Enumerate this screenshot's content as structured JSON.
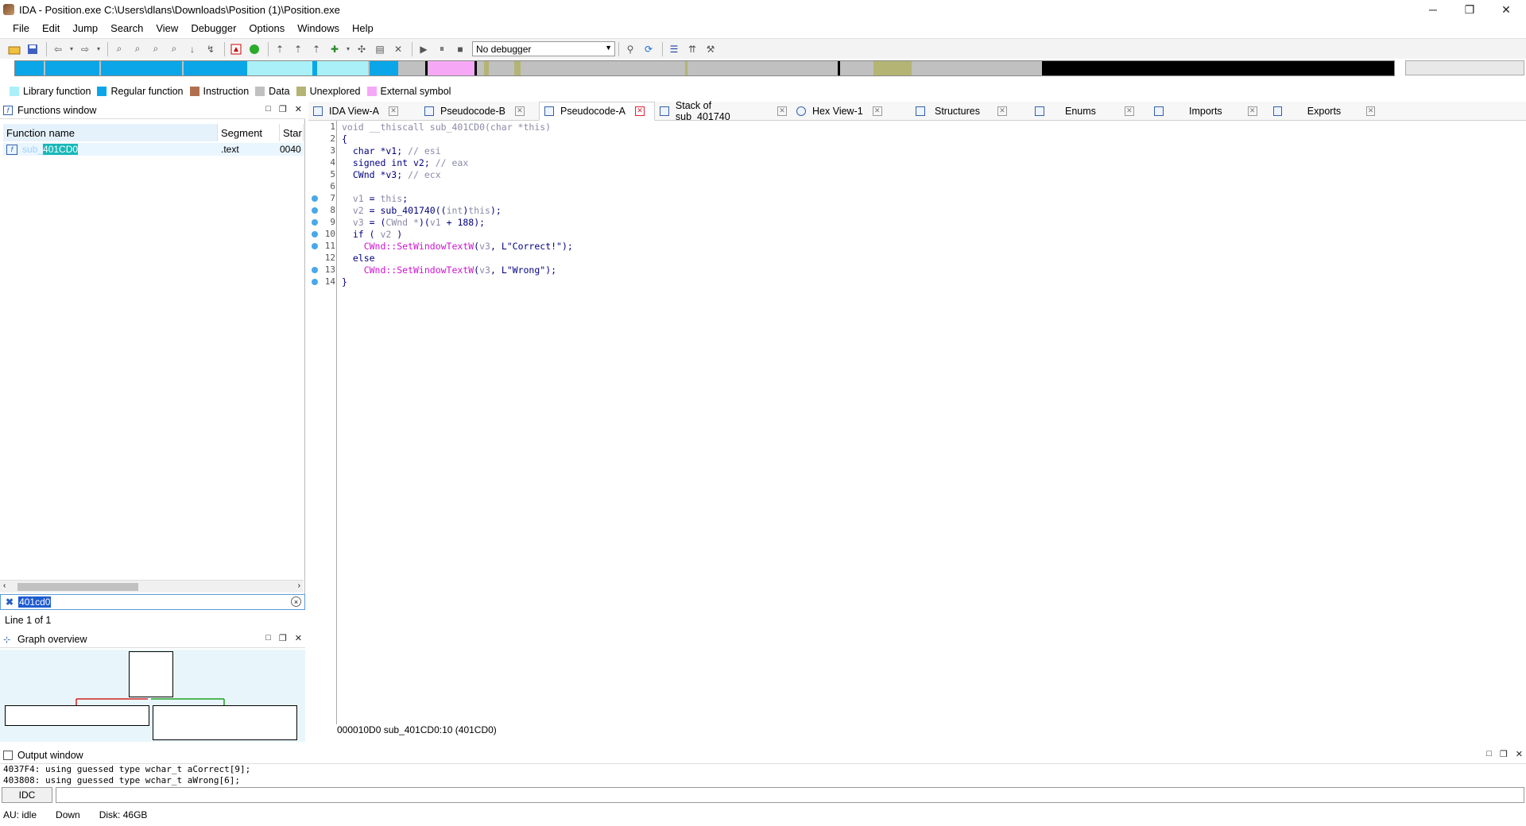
{
  "window": {
    "title": "IDA - Position.exe C:\\Users\\dlans\\Downloads\\Position (1)\\Position.exe",
    "minimize": "─",
    "restore": "❐",
    "close": "✕"
  },
  "menu": [
    "File",
    "Edit",
    "Jump",
    "Search",
    "View",
    "Debugger",
    "Options",
    "Windows",
    "Help"
  ],
  "toolbar": {
    "debugger_select": "No debugger"
  },
  "legend": [
    {
      "label": "Library function",
      "color": "#aaf0f8"
    },
    {
      "label": "Regular function",
      "color": "#0aa6e8"
    },
    {
      "label": "Instruction",
      "color": "#b07050"
    },
    {
      "label": "Data",
      "color": "#c0c0c0"
    },
    {
      "label": "Unexplored",
      "color": "#b4b474"
    },
    {
      "label": "External symbol",
      "color": "#f6a8f6"
    }
  ],
  "functions_window": {
    "title": "Functions window",
    "columns": [
      "Function name",
      "Segment",
      "Star"
    ],
    "rows": [
      {
        "name_prefix": "sub_",
        "name_highlight": "401CD0",
        "segment": ".text",
        "start": "0040"
      }
    ],
    "filter_value": "401cd0",
    "line_info": "Line 1 of 1"
  },
  "graph_overview": {
    "title": "Graph overview"
  },
  "tabs": [
    {
      "label": "IDA View-A",
      "active": false
    },
    {
      "label": "Pseudocode-B",
      "active": false
    },
    {
      "label": "Pseudocode-A",
      "active": true
    },
    {
      "label": "Stack of sub_401740",
      "active": false
    },
    {
      "label": "Hex View-1",
      "active": false
    },
    {
      "label": "Structures",
      "active": false
    },
    {
      "label": "Enums",
      "active": false
    },
    {
      "label": "Imports",
      "active": false
    },
    {
      "label": "Exports",
      "active": false
    }
  ],
  "code": {
    "lines": [
      {
        "n": "1",
        "dot": false
      },
      {
        "n": "2",
        "dot": false
      },
      {
        "n": "3",
        "dot": false
      },
      {
        "n": "4",
        "dot": false
      },
      {
        "n": "5",
        "dot": false
      },
      {
        "n": "6",
        "dot": false
      },
      {
        "n": "7",
        "dot": true
      },
      {
        "n": "8",
        "dot": true
      },
      {
        "n": "9",
        "dot": true
      },
      {
        "n": "10",
        "dot": true
      },
      {
        "n": "11",
        "dot": true
      },
      {
        "n": "12",
        "dot": false
      },
      {
        "n": "13",
        "dot": true
      },
      {
        "n": "14",
        "dot": true
      }
    ],
    "l1": "void __thiscall sub_401CD0(char *this)",
    "l2": "{",
    "l3a": "  char *v1; ",
    "l3b": "// esi",
    "l4a": "  signed int v2; ",
    "l4b": "// eax",
    "l5a": "  CWnd *v3; ",
    "l5b": "// ecx",
    "l7a": "  v1",
    "l7b": " = ",
    "l7c": "this",
    "l7d": ";",
    "l8a": "  v2",
    "l8b": " = sub_401740((",
    "l8c": "int",
    "l8d": ")",
    "l8e": "this",
    "l8f": ");",
    "l9a": "  v3",
    "l9b": " = (",
    "l9c": "CWnd *",
    "l9d": ")(",
    "l9e": "v1",
    "l9f": " + 188);",
    "l10a": "  if ( ",
    "l10b": "v2",
    "l10c": " )",
    "l11a": "    CWnd::SetWindowTextW",
    "l11b": "(",
    "l11c": "v3",
    "l11d": ", L\"Correct!\");",
    "l12": "  else",
    "l13a": "    CWnd::SetWindowTextW",
    "l13b": "(",
    "l13c": "v3",
    "l13d": ", L\"Wrong\");",
    "l14": "}",
    "status": "000010D0  sub_401CD0:10 (401CD0)"
  },
  "output_window": {
    "title": "Output window",
    "line1": "4037F4: using guessed type wchar_t aCorrect[9];",
    "line2": "403808: using guessed type wchar_t aWrong[6];",
    "idc_label": "IDC"
  },
  "status": {
    "au": "AU:  idle",
    "dir": "Down",
    "disk": "Disk: 46GB"
  }
}
